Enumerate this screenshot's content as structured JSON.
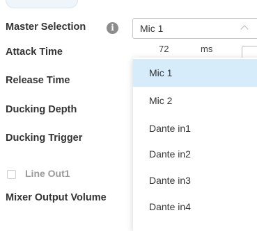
{
  "form": {
    "labels": {
      "master_selection": "Master Selection",
      "attack_time": "Attack Time",
      "release_time": "Release Time",
      "ducking_depth": "Ducking Depth",
      "ducking_trigger": "Ducking Trigger",
      "mixer_output_volume": "Mixer Output Volume"
    },
    "info_icon_glyph": "i",
    "attack_time_value": "72",
    "attack_time_unit": "ms",
    "line_out": {
      "label": "Line Out1",
      "checked": false
    }
  },
  "master_select": {
    "value": "Mic 1",
    "expanded": true,
    "options": [
      "Mic 1",
      "Mic 2",
      "Dante in1",
      "Dante in2",
      "Dante in3",
      "Dante in4"
    ],
    "selected_index": 0,
    "highlight_color": "#d6ecfb"
  },
  "colors": {
    "label_text": "#333333",
    "disabled_text": "#9a9a9a",
    "info_icon": "#8c8c8c",
    "border": "#c9c9c9"
  }
}
